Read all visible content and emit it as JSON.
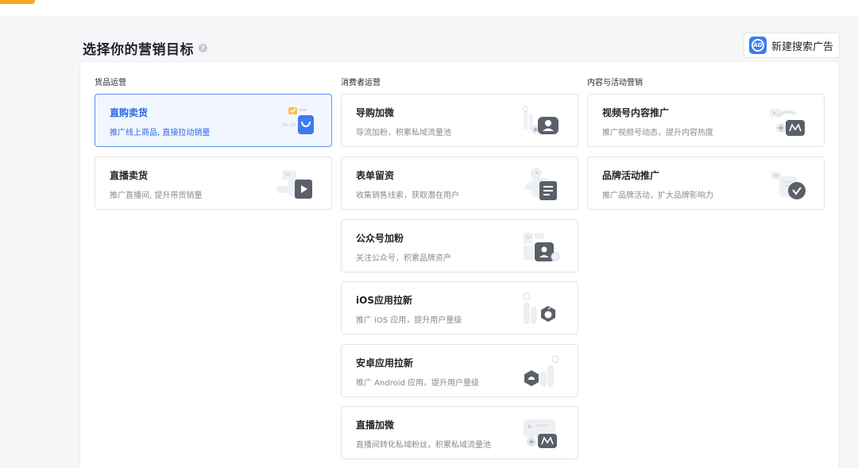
{
  "header": {
    "title": "选择你的营销目标",
    "new_ad_button": "新建搜索广告",
    "new_ad_icon_text": "AD"
  },
  "colors": {
    "accent": "#2d67e8",
    "selected_bg": "#f2f6fe",
    "brand_orange": "#f5a623"
  },
  "columns": [
    {
      "label": "货品运营",
      "cards": [
        {
          "title": "直购卖货",
          "desc": "推广线上商品, 直接拉动销量",
          "selected": true,
          "icon": "shopping-bag-icon"
        },
        {
          "title": "直播卖货",
          "desc": "推广直播间, 提升带货销量",
          "selected": false,
          "icon": "live-play-icon"
        }
      ]
    },
    {
      "label": "消费者运营",
      "cards": [
        {
          "title": "导购加微",
          "desc": "导流加粉，积累私域流量池",
          "icon": "add-friend-icon"
        },
        {
          "title": "表单留资",
          "desc": "收集销售线索，获取潜在用户",
          "icon": "form-document-icon"
        },
        {
          "title": "公众号加粉",
          "desc": "关注公众号，积累品牌资产",
          "icon": "official-account-icon"
        },
        {
          "title": "iOS应用拉新",
          "desc": "推广 iOS 应用，提升用户量级",
          "icon": "apple-app-icon"
        },
        {
          "title": "安卓应用拉新",
          "desc": "推广 Android 应用，提升用户量级",
          "icon": "android-app-icon"
        },
        {
          "title": "直播加微",
          "desc": "直播间转化私域粉丝，积累私域流量池",
          "icon": "live-add-friend-icon"
        }
      ]
    },
    {
      "label": "内容与活动营销",
      "cards": [
        {
          "title": "视频号内容推广",
          "desc": "推广视频号动态，提升内容热度",
          "icon": "channels-video-icon"
        },
        {
          "title": "品牌活动推广",
          "desc": "推广品牌活动，扩大品牌影响力",
          "icon": "brand-campaign-icon"
        }
      ]
    }
  ]
}
